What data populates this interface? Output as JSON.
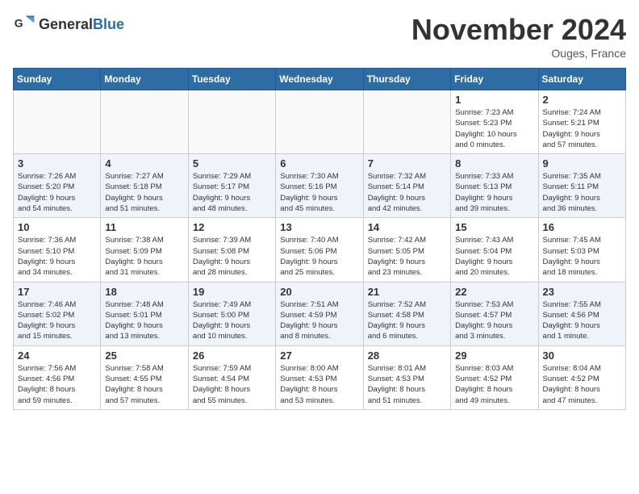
{
  "header": {
    "logo_general": "General",
    "logo_blue": "Blue",
    "month_title": "November 2024",
    "location": "Ouges, France"
  },
  "weekdays": [
    "Sunday",
    "Monday",
    "Tuesday",
    "Wednesday",
    "Thursday",
    "Friday",
    "Saturday"
  ],
  "weeks": [
    [
      {
        "day": "",
        "info": ""
      },
      {
        "day": "",
        "info": ""
      },
      {
        "day": "",
        "info": ""
      },
      {
        "day": "",
        "info": ""
      },
      {
        "day": "",
        "info": ""
      },
      {
        "day": "1",
        "info": "Sunrise: 7:23 AM\nSunset: 5:23 PM\nDaylight: 10 hours\nand 0 minutes."
      },
      {
        "day": "2",
        "info": "Sunrise: 7:24 AM\nSunset: 5:21 PM\nDaylight: 9 hours\nand 57 minutes."
      }
    ],
    [
      {
        "day": "3",
        "info": "Sunrise: 7:26 AM\nSunset: 5:20 PM\nDaylight: 9 hours\nand 54 minutes."
      },
      {
        "day": "4",
        "info": "Sunrise: 7:27 AM\nSunset: 5:18 PM\nDaylight: 9 hours\nand 51 minutes."
      },
      {
        "day": "5",
        "info": "Sunrise: 7:29 AM\nSunset: 5:17 PM\nDaylight: 9 hours\nand 48 minutes."
      },
      {
        "day": "6",
        "info": "Sunrise: 7:30 AM\nSunset: 5:16 PM\nDaylight: 9 hours\nand 45 minutes."
      },
      {
        "day": "7",
        "info": "Sunrise: 7:32 AM\nSunset: 5:14 PM\nDaylight: 9 hours\nand 42 minutes."
      },
      {
        "day": "8",
        "info": "Sunrise: 7:33 AM\nSunset: 5:13 PM\nDaylight: 9 hours\nand 39 minutes."
      },
      {
        "day": "9",
        "info": "Sunrise: 7:35 AM\nSunset: 5:11 PM\nDaylight: 9 hours\nand 36 minutes."
      }
    ],
    [
      {
        "day": "10",
        "info": "Sunrise: 7:36 AM\nSunset: 5:10 PM\nDaylight: 9 hours\nand 34 minutes."
      },
      {
        "day": "11",
        "info": "Sunrise: 7:38 AM\nSunset: 5:09 PM\nDaylight: 9 hours\nand 31 minutes."
      },
      {
        "day": "12",
        "info": "Sunrise: 7:39 AM\nSunset: 5:08 PM\nDaylight: 9 hours\nand 28 minutes."
      },
      {
        "day": "13",
        "info": "Sunrise: 7:40 AM\nSunset: 5:06 PM\nDaylight: 9 hours\nand 25 minutes."
      },
      {
        "day": "14",
        "info": "Sunrise: 7:42 AM\nSunset: 5:05 PM\nDaylight: 9 hours\nand 23 minutes."
      },
      {
        "day": "15",
        "info": "Sunrise: 7:43 AM\nSunset: 5:04 PM\nDaylight: 9 hours\nand 20 minutes."
      },
      {
        "day": "16",
        "info": "Sunrise: 7:45 AM\nSunset: 5:03 PM\nDaylight: 9 hours\nand 18 minutes."
      }
    ],
    [
      {
        "day": "17",
        "info": "Sunrise: 7:46 AM\nSunset: 5:02 PM\nDaylight: 9 hours\nand 15 minutes."
      },
      {
        "day": "18",
        "info": "Sunrise: 7:48 AM\nSunset: 5:01 PM\nDaylight: 9 hours\nand 13 minutes."
      },
      {
        "day": "19",
        "info": "Sunrise: 7:49 AM\nSunset: 5:00 PM\nDaylight: 9 hours\nand 10 minutes."
      },
      {
        "day": "20",
        "info": "Sunrise: 7:51 AM\nSunset: 4:59 PM\nDaylight: 9 hours\nand 8 minutes."
      },
      {
        "day": "21",
        "info": "Sunrise: 7:52 AM\nSunset: 4:58 PM\nDaylight: 9 hours\nand 6 minutes."
      },
      {
        "day": "22",
        "info": "Sunrise: 7:53 AM\nSunset: 4:57 PM\nDaylight: 9 hours\nand 3 minutes."
      },
      {
        "day": "23",
        "info": "Sunrise: 7:55 AM\nSunset: 4:56 PM\nDaylight: 9 hours\nand 1 minute."
      }
    ],
    [
      {
        "day": "24",
        "info": "Sunrise: 7:56 AM\nSunset: 4:56 PM\nDaylight: 8 hours\nand 59 minutes."
      },
      {
        "day": "25",
        "info": "Sunrise: 7:58 AM\nSunset: 4:55 PM\nDaylight: 8 hours\nand 57 minutes."
      },
      {
        "day": "26",
        "info": "Sunrise: 7:59 AM\nSunset: 4:54 PM\nDaylight: 8 hours\nand 55 minutes."
      },
      {
        "day": "27",
        "info": "Sunrise: 8:00 AM\nSunset: 4:53 PM\nDaylight: 8 hours\nand 53 minutes."
      },
      {
        "day": "28",
        "info": "Sunrise: 8:01 AM\nSunset: 4:53 PM\nDaylight: 8 hours\nand 51 minutes."
      },
      {
        "day": "29",
        "info": "Sunrise: 8:03 AM\nSunset: 4:52 PM\nDaylight: 8 hours\nand 49 minutes."
      },
      {
        "day": "30",
        "info": "Sunrise: 8:04 AM\nSunset: 4:52 PM\nDaylight: 8 hours\nand 47 minutes."
      }
    ]
  ]
}
